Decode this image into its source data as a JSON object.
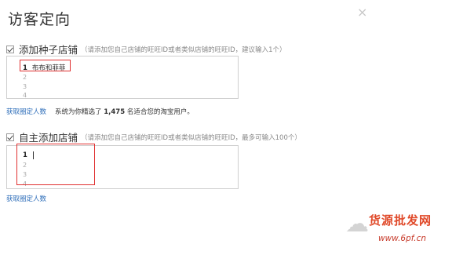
{
  "dialog": {
    "title": "访客定向",
    "close_icon": "×"
  },
  "section1": {
    "label": "添加种子店铺",
    "hint": "（请添加您自己店铺的旺旺ID或者类似店铺的旺旺ID，建议输入1个）",
    "lines": [
      {
        "num": "1",
        "value": "布布和菲菲"
      },
      {
        "num": "2",
        "value": ""
      },
      {
        "num": "3",
        "value": ""
      },
      {
        "num": "4",
        "value": ""
      }
    ],
    "fetch_link": "获取圈定人数",
    "result_prefix": "系统为你精选了",
    "result_count": "1,475",
    "result_suffix": "名适合您的淘宝用户。"
  },
  "section2": {
    "label": "自主添加店铺",
    "hint": "（请添加您自己店铺的旺旺ID或者类似店铺的旺旺ID，最多可输入100个）",
    "lines": [
      {
        "num": "1",
        "value": ""
      },
      {
        "num": "2",
        "value": ""
      },
      {
        "num": "3",
        "value": ""
      },
      {
        "num": "4",
        "value": ""
      }
    ],
    "fetch_link": "获取圈定人数"
  },
  "watermark": {
    "text": "货源批发网",
    "url": "www.6pf.cn"
  },
  "colors": {
    "link": "#2a6bb8",
    "highlight_border": "#e03030",
    "watermark": "#e04a2a"
  }
}
